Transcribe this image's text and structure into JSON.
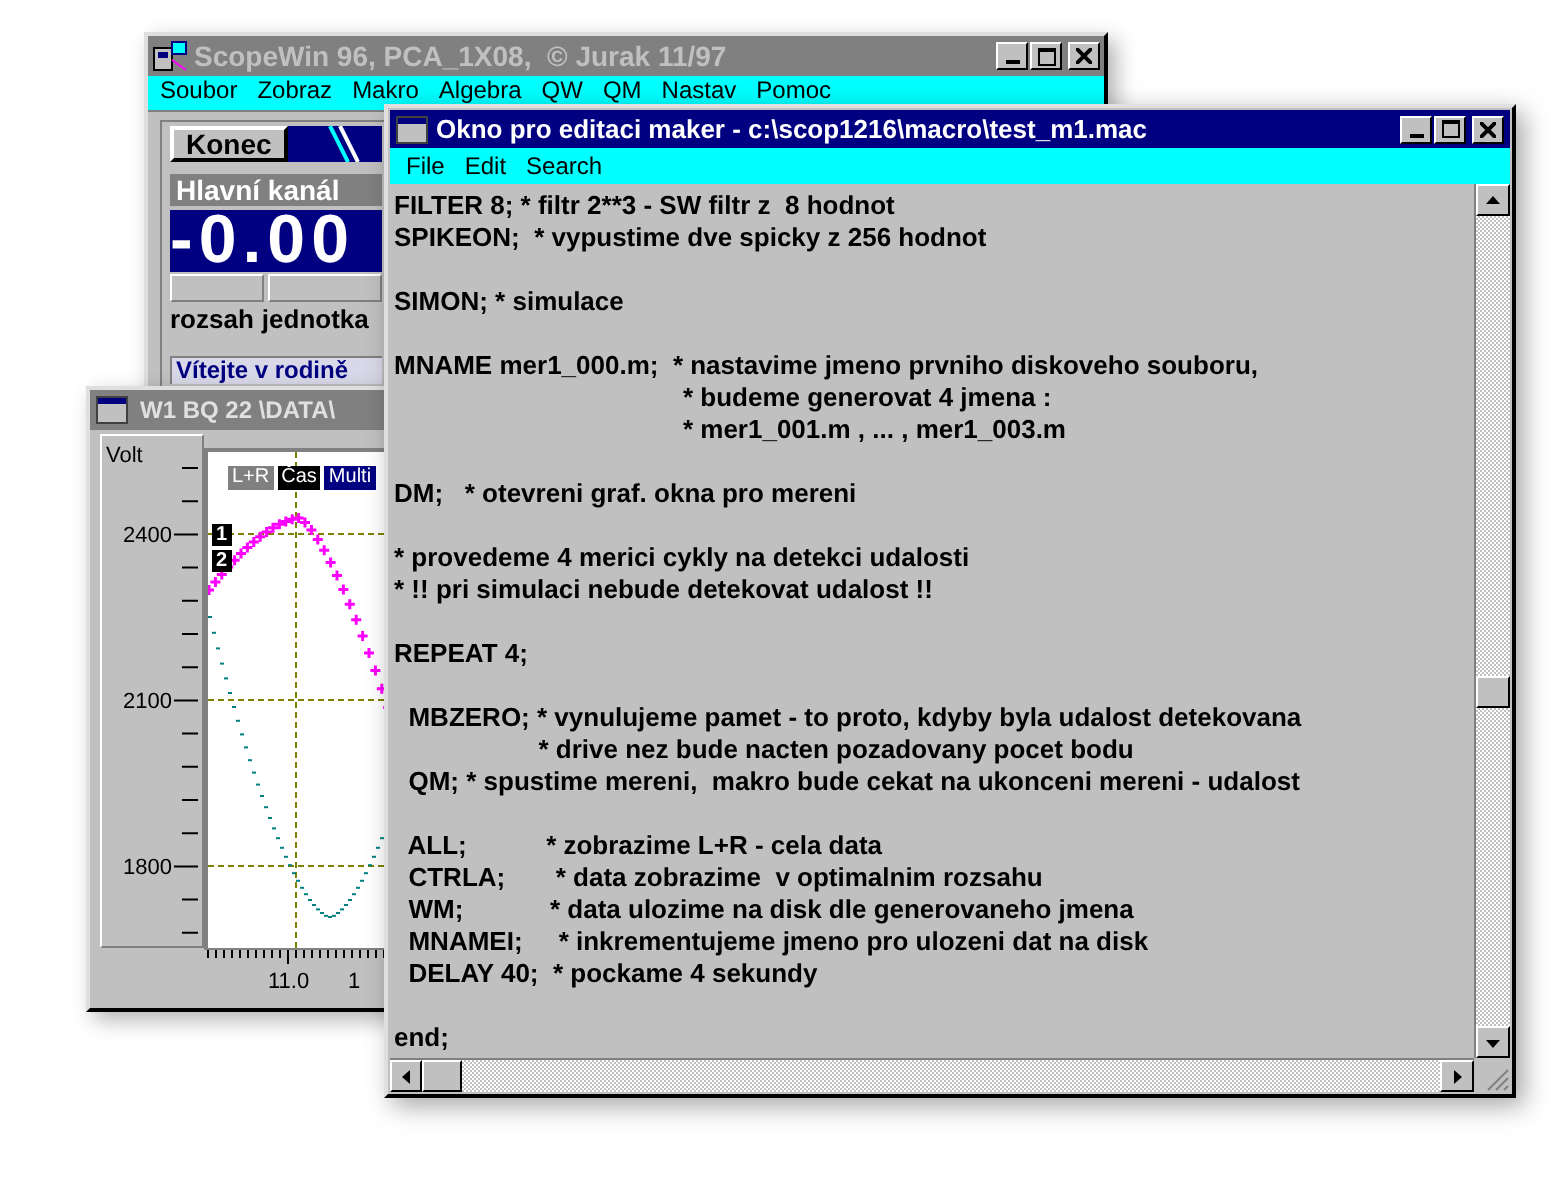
{
  "scope_window": {
    "title": "ScopeWin 96, PCA_1X08,  © Jurak 11/97",
    "menu": [
      "Soubor",
      "Zobraz",
      "Makro",
      "Algebra",
      "QW",
      "QM",
      "Nastav",
      "Pomoc"
    ],
    "exit_button": "Konec",
    "channel_label": "Hlavní kanál",
    "display_value": "-0.00",
    "field_labels": [
      "rozsah",
      "jednotka"
    ],
    "welcome_text": "Vítejte v rodině"
  },
  "graph_window": {
    "title": "W1 BQ 22 \\DATA\\",
    "y_unit": "Volt",
    "y_labels": [
      "2400",
      "2100",
      "1800"
    ],
    "x_labels": [
      "11.0",
      "1"
    ],
    "tags": [
      {
        "label": "L+R",
        "color": "#808080"
      },
      {
        "label": "Čas",
        "color": "#000000"
      },
      {
        "label": "Multi",
        "color": "#000080"
      }
    ],
    "markers": [
      "1",
      "2"
    ]
  },
  "editor_window": {
    "title": "Okno pro editaci maker - c:\\scop1216\\macro\\test_m1.mac",
    "menu": [
      "File",
      "Edit",
      "Search"
    ],
    "blocks": [
      [
        "FILTER 8; * filtr 2**3 - SW filtr z  8 hodnot",
        "SPIKEON;  * vypustime dve spicky z 256 hodnot"
      ],
      [
        "SIMON; * simulace"
      ],
      [
        "MNAME mer1_000.m;  * nastavime jmeno prvniho diskoveho souboru,",
        "                                        * budeme generovat 4 jmena :",
        "                                        * mer1_001.m , ... , mer1_003.m"
      ],
      [
        "DM;   * otevreni graf. okna pro mereni"
      ],
      [
        "* provedeme 4 merici cykly na detekci udalosti",
        "* !! pri simulaci nebude detekovat udalost !!"
      ],
      [
        "REPEAT 4;"
      ],
      [
        "  MBZERO; * vynulujeme pamet - to proto, kdyby byla udalost detekovana",
        "                    * drive nez bude nacten pozadovany pocet bodu",
        "  QM; * spustime mereni,  makro bude cekat na ukonceni mereni - udalost"
      ],
      [
        "  ALL;           * zobrazime L+R - cela data",
        "  CTRLA;       * data zobrazime  v optimalnim rozsahu",
        "  WM;            * data ulozime na disk dle generovaneho jmena",
        "  MNAMEI;     * inkrementujeme jmeno pro ulozeni dat na disk",
        "  DELAY 40;  * pockame 4 sekundy"
      ],
      [
        "end;"
      ]
    ]
  }
}
